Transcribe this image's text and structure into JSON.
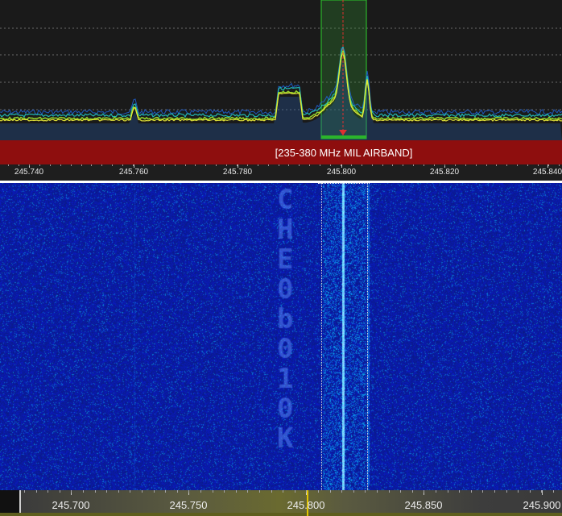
{
  "band_plan": {
    "label": "[235-380 MHz MIL AIRBAND]",
    "color": "#8e0e0e"
  },
  "spectrum": {
    "background": "#1a1a1a",
    "trace_colors": [
      "#1f5fd0",
      "#22c8c0",
      "#9be12b",
      "#f2f23a"
    ],
    "filter_color": "#2bb52b",
    "tuning_marker_color": "#e03030"
  },
  "top_scale": {
    "ticks": [
      {
        "label": "245.740"
      },
      {
        "label": "245.760"
      },
      {
        "label": "245.780"
      },
      {
        "label": "245.800"
      },
      {
        "label": "245.820"
      },
      {
        "label": "245.840"
      }
    ]
  },
  "waterfall": {
    "background": "#0d1b8a",
    "signal_color": "#5fc8ff",
    "visible_text": "CH E0b010K"
  },
  "bottom_scale": {
    "ticks": [
      {
        "label": "245.700"
      },
      {
        "label": "245.750"
      },
      {
        "label": "245.800"
      },
      {
        "label": "245.850"
      },
      {
        "label": "245.900"
      }
    ],
    "cursor_color": "#e2c400"
  }
}
